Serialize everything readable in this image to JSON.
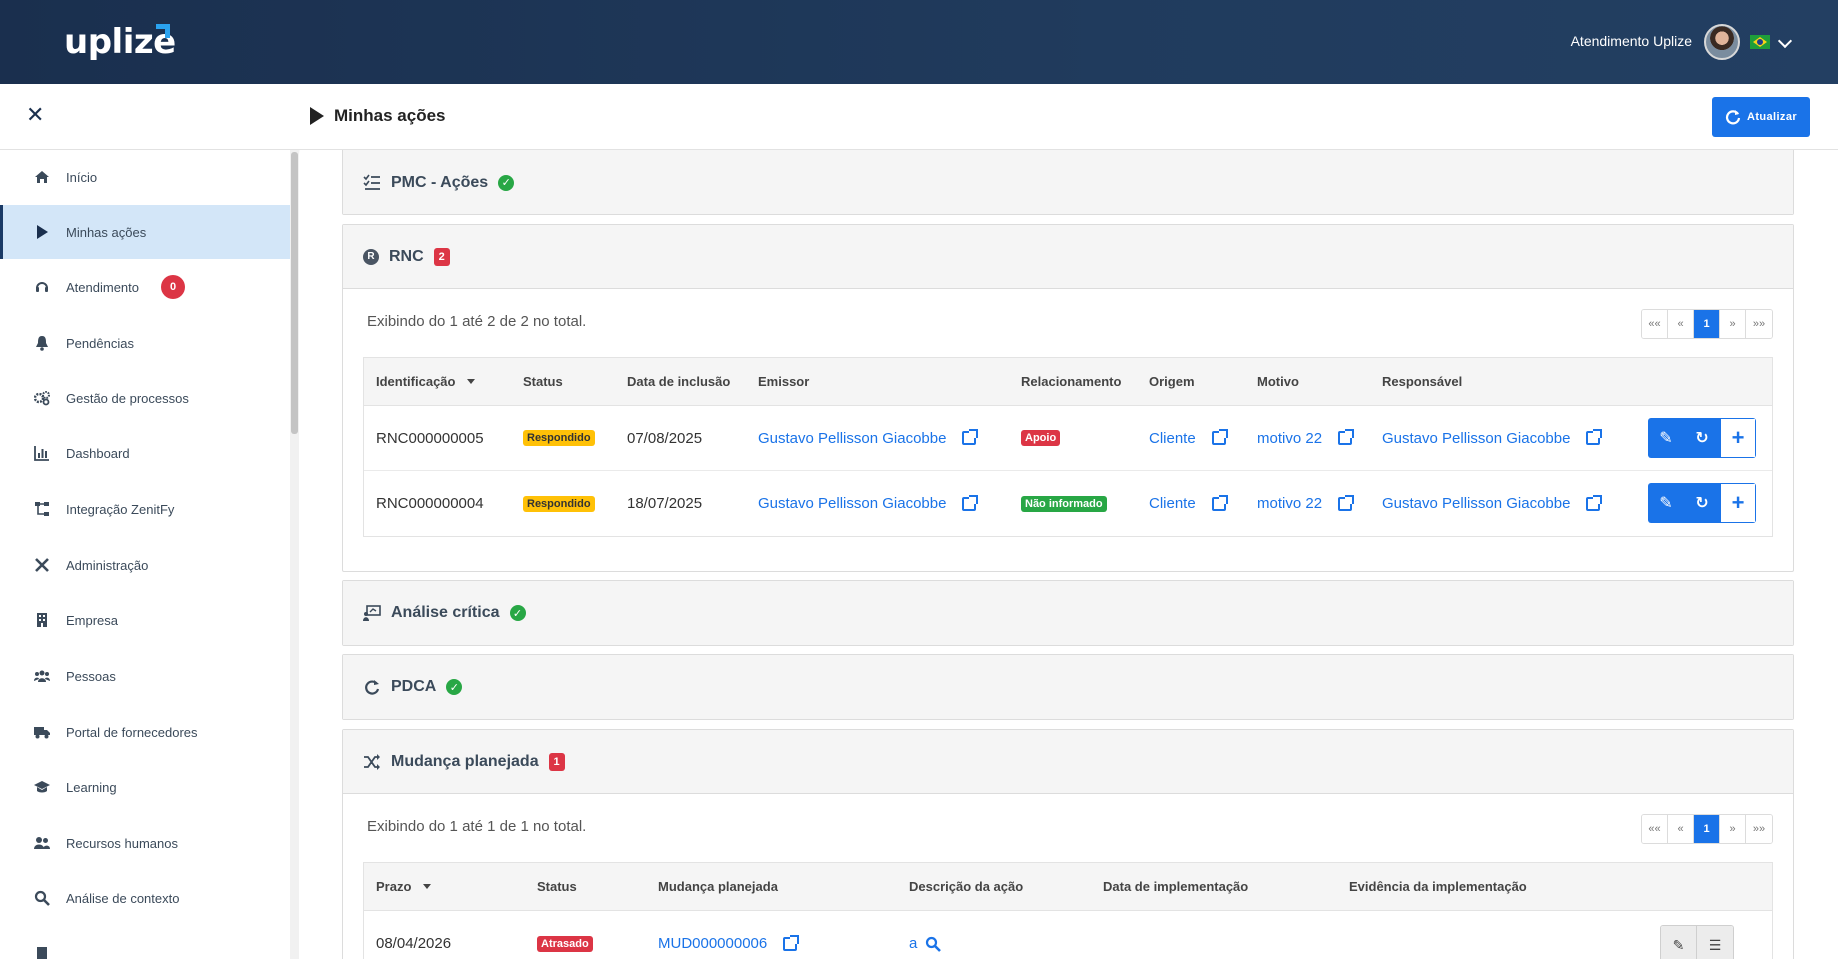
{
  "header": {
    "logo": "uplize",
    "user_name": "Atendimento Uplize"
  },
  "subheader": {
    "page_title": "Minhas ações",
    "refresh_label": "Atualizar"
  },
  "sidebar": {
    "items": [
      {
        "label": "Início",
        "icon": "home-icon"
      },
      {
        "label": "Minhas ações",
        "icon": "play-icon",
        "active": true
      },
      {
        "label": "Atendimento",
        "icon": "headset-icon",
        "badge": "0"
      },
      {
        "label": "Pendências",
        "icon": "bell-icon"
      },
      {
        "label": "Gestão de processos",
        "icon": "gears-icon"
      },
      {
        "label": "Dashboard",
        "icon": "chart-icon"
      },
      {
        "label": "Integração ZenitFy",
        "icon": "network-icon"
      },
      {
        "label": "Administração",
        "icon": "tools-icon"
      },
      {
        "label": "Empresa",
        "icon": "building-icon"
      },
      {
        "label": "Pessoas",
        "icon": "people-icon"
      },
      {
        "label": "Portal de fornecedores",
        "icon": "truck-icon"
      },
      {
        "label": "Learning",
        "icon": "graduation-cap-icon"
      },
      {
        "label": "Recursos humanos",
        "icon": "users-icon"
      },
      {
        "label": "Análise de contexto",
        "icon": "search-icon"
      }
    ]
  },
  "sections": {
    "pmc": {
      "title": "PMC - Ações"
    },
    "rnc": {
      "title": "RNC",
      "count": "2",
      "showing": "Exibindo do 1 até 2 de 2 no total.",
      "pager": {
        "first": "««",
        "prev": "«",
        "current": "1",
        "next": "»",
        "last": "»»"
      },
      "columns": [
        "Identificação",
        "Status",
        "Data de inclusão",
        "Emissor",
        "Relacionamento",
        "Origem",
        "Motivo",
        "Responsável"
      ],
      "rows": [
        {
          "id": "RNC000000005",
          "status": "Respondido",
          "date": "07/08/2025",
          "emissor": "Gustavo  Pellisson Giacobbe",
          "relacionamento": "Apoio",
          "origem": "Cliente",
          "motivo": "motivo 22",
          "responsavel": "Gustavo  Pellisson Giacobbe"
        },
        {
          "id": "RNC000000004",
          "status": "Respondido",
          "date": "18/07/2025",
          "emissor": "Gustavo  Pellisson Giacobbe",
          "relacionamento": "Não informado",
          "origem": "Cliente",
          "motivo": "motivo 22",
          "responsavel": "Gustavo  Pellisson Giacobbe"
        }
      ]
    },
    "analise": {
      "title": "Análise crítica"
    },
    "pdca": {
      "title": "PDCA"
    },
    "mudanca": {
      "title": "Mudança planejada",
      "count": "1",
      "showing": "Exibindo do 1 até 1 de 1 no total.",
      "pager": {
        "first": "««",
        "prev": "«",
        "current": "1",
        "next": "»",
        "last": "»»"
      },
      "columns": [
        "Prazo",
        "Status",
        "Mudança planejada",
        "Descrição da ação",
        "Data de implementação",
        "Evidência da implementação"
      ],
      "rows": [
        {
          "prazo": "08/04/2026",
          "status": "Atrasado",
          "mudanca": "MUD000000006",
          "descricao": "a"
        }
      ]
    }
  },
  "colors": {
    "header_bg": "#1a2f4e",
    "accent": "#1a73e8",
    "danger": "#dc3545",
    "success": "#28a745",
    "warning": "#ffc107"
  }
}
